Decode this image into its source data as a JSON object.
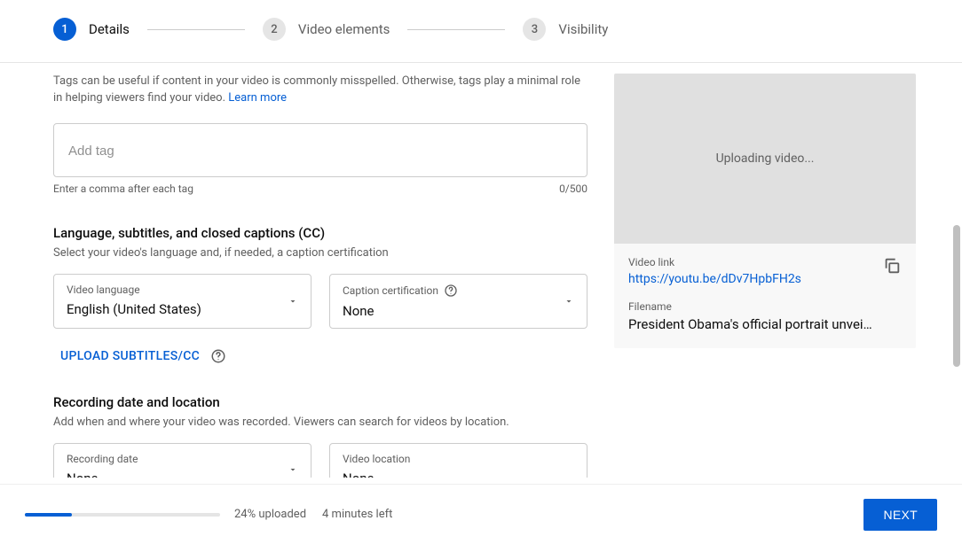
{
  "stepper": {
    "steps": [
      {
        "num": "1",
        "label": "Details"
      },
      {
        "num": "2",
        "label": "Video elements"
      },
      {
        "num": "3",
        "label": "Visibility"
      }
    ]
  },
  "tags": {
    "helper": "Tags can be useful if content in your video is commonly misspelled. Otherwise, tags play a minimal role in helping viewers find your video. ",
    "learn_more": "Learn more",
    "placeholder": "Add tag",
    "footer_hint": "Enter a comma after each tag",
    "counter": "0/500"
  },
  "lang": {
    "title": "Language, subtitles, and closed captions (CC)",
    "sub": "Select your video's language and, if needed, a caption certification",
    "video_language_label": "Video language",
    "video_language_value": "English (United States)",
    "caption_cert_label": "Caption certification",
    "caption_cert_value": "None",
    "upload_subtitles": "UPLOAD SUBTITLES/CC"
  },
  "recording": {
    "title": "Recording date and location",
    "sub": "Add when and where your video was recorded. Viewers can search for videos by location.",
    "date_label": "Recording date",
    "date_value": "None",
    "location_label": "Video location",
    "location_value": "None"
  },
  "preview": {
    "thumb_text": "Uploading video...",
    "link_label": "Video link",
    "link_value": "https://youtu.be/dDv7HpbFH2s",
    "filename_label": "Filename",
    "filename_value": "President Obama's official portrait unvei…"
  },
  "footer": {
    "progress_pct": 24,
    "upload_status": "24% uploaded",
    "time_left": "4 minutes left",
    "next": "NEXT"
  }
}
